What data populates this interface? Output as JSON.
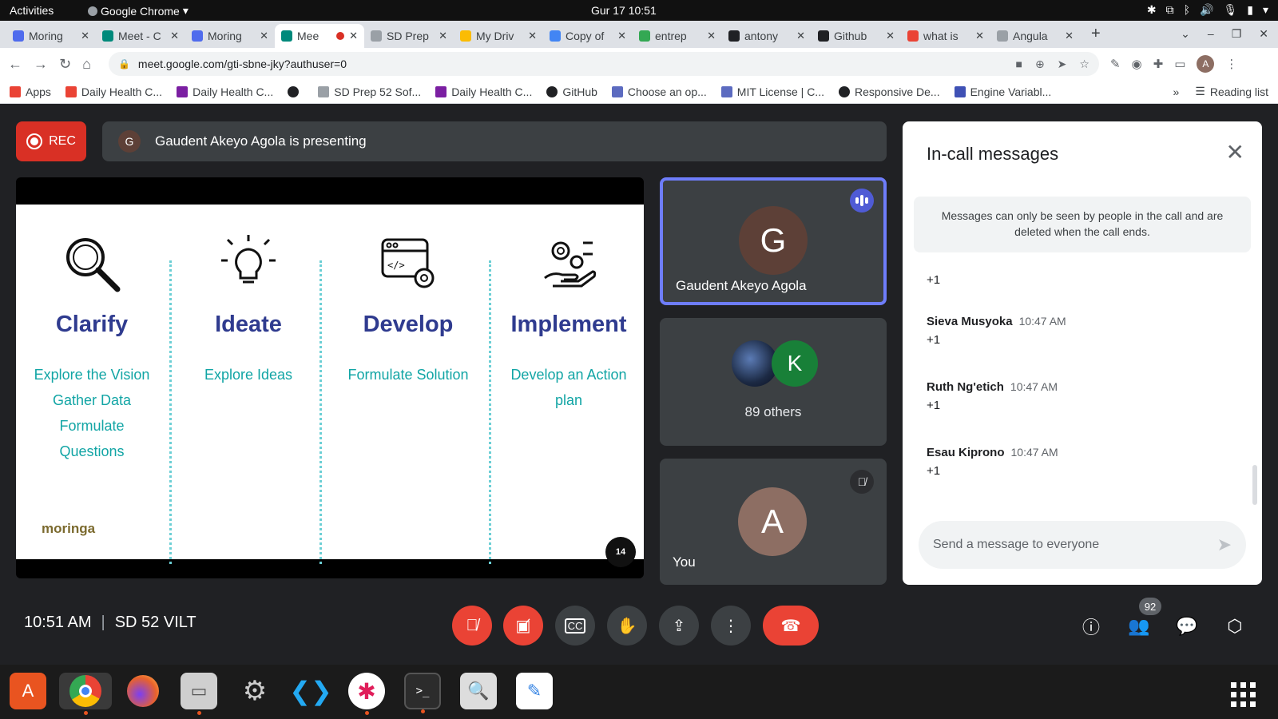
{
  "system": {
    "activities": "Activities",
    "app_menu": "Google Chrome",
    "clock": "Gur 17  10:51"
  },
  "tabs": [
    {
      "label": "Moring",
      "color": "#4f6bed"
    },
    {
      "label": "Meet - C",
      "color": "#00897b"
    },
    {
      "label": "Moring",
      "color": "#4f6bed"
    },
    {
      "label": "Mee",
      "color": "#00897b",
      "active": true
    },
    {
      "label": "SD Prep",
      "color": "#9aa0a6"
    },
    {
      "label": "My Driv",
      "color": "#fbbc04"
    },
    {
      "label": "Copy of",
      "color": "#4285f4"
    },
    {
      "label": "entrep",
      "color": "#34a853"
    },
    {
      "label": "antony",
      "color": "#202124"
    },
    {
      "label": "Github",
      "color": "#202124"
    },
    {
      "label": "what is",
      "color": "#ea4335"
    },
    {
      "label": "Angula",
      "color": "#9aa0a6"
    }
  ],
  "address": {
    "url": "meet.google.com/gti-sbne-jky?authuser=0",
    "profile_letter": "A"
  },
  "bookmarks": [
    {
      "label": "Apps",
      "color": "#ea4335"
    },
    {
      "label": "Daily Health C...",
      "color": "#ea4335"
    },
    {
      "label": "Daily Health C...",
      "color": "#7b1fa2"
    },
    {
      "label": "",
      "color": "#202124"
    },
    {
      "label": "SD Prep 52 Sof...",
      "color": "#9aa0a6"
    },
    {
      "label": "Daily Health C...",
      "color": "#7b1fa2"
    },
    {
      "label": "GitHub",
      "color": "#202124"
    },
    {
      "label": "Choose an op...",
      "color": "#5c6bc0"
    },
    {
      "label": "MIT License | C...",
      "color": "#5c6bc0"
    },
    {
      "label": "Responsive De...",
      "color": "#202124"
    },
    {
      "label": "Engine Variabl...",
      "color": "#3f51b5"
    }
  ],
  "bookmarks_more": "»",
  "reading_list": "Reading list",
  "meet": {
    "rec_label": "REC",
    "presenter_initial": "G",
    "presenting_text": "Gaudent Akeyo Agola is presenting",
    "slide": {
      "columns": [
        {
          "heading": "Clarify",
          "lines": [
            "Explore the Vision",
            "Gather Data",
            "Formulate",
            "Questions"
          ]
        },
        {
          "heading": "Ideate",
          "lines": [
            "Explore Ideas"
          ]
        },
        {
          "heading": "Develop",
          "lines": [
            "Formulate Solution"
          ]
        },
        {
          "heading": "Implement",
          "lines": [
            "Develop an Action",
            "plan"
          ]
        }
      ],
      "logo": "moringa",
      "page_number": "14"
    },
    "participants": {
      "speaker": {
        "initial": "G",
        "name": "Gaudent Akeyo Agola",
        "color": "#5d4037"
      },
      "others": {
        "initial": "K",
        "label": "89 others",
        "color": "#188038"
      },
      "self": {
        "initial": "A",
        "name": "You",
        "color": "#8d6e63"
      }
    },
    "chat": {
      "title": "In-call messages",
      "notice": "Messages can only be seen by people in the call and are deleted when the call ends.",
      "first_body": "+1",
      "messages": [
        {
          "sender": "Sieva Musyoka",
          "time": "10:47 AM",
          "body": "+1"
        },
        {
          "sender": "Ruth Ng'etich",
          "time": "10:47 AM",
          "body": "+1"
        },
        {
          "sender": "Esau Kiprono",
          "time": "10:47 AM",
          "body": "+1"
        }
      ],
      "input_placeholder": "Send a message to everyone"
    },
    "bottom": {
      "time": "10:51 AM",
      "separator": "|",
      "meeting_code": "SD 52 VILT",
      "people_count": "92"
    }
  }
}
